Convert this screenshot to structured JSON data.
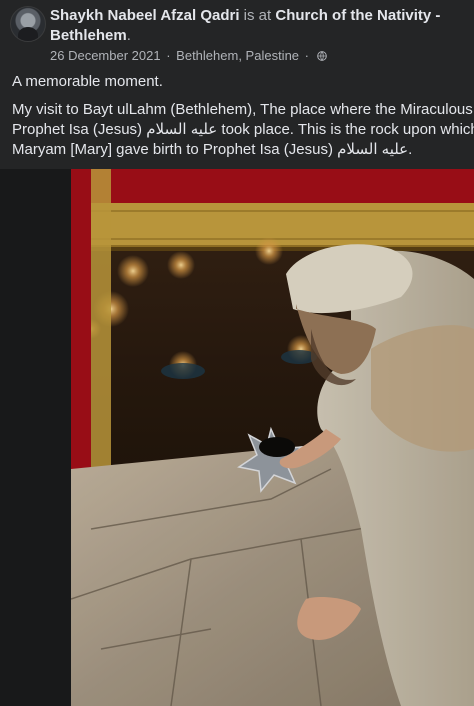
{
  "post": {
    "author": "Shaykh Nabeel Afzal Qadri",
    "connector": " is at ",
    "place": "Church of the Nativity - Bethlehem",
    "place_end": ".",
    "date": "26 December 2021",
    "separator": "·",
    "location": "Bethlehem, Palestine",
    "audience_icon": "globe-icon",
    "text_line1": "A memorable moment.",
    "text_body": [
      "My visit to Bayt ulLahm (Bethlehem), The place where the Miraculous Birth of",
      "Prophet Isa (Jesus) عليه السلام took place. This is the rock upon which Sayyida",
      "Maryam [Mary] gave birth to Prophet Isa (Jesus) عليه السلام."
    ],
    "photo_alt": "Man kneeling at the silver star in the Grotto of the Nativity"
  },
  "colors": {
    "background": "#242526",
    "text_primary": "#e4e6eb",
    "text_secondary": "#b0b3b8",
    "curtain_red": "#b3121b",
    "fringe_gold": "#d9b24a"
  }
}
